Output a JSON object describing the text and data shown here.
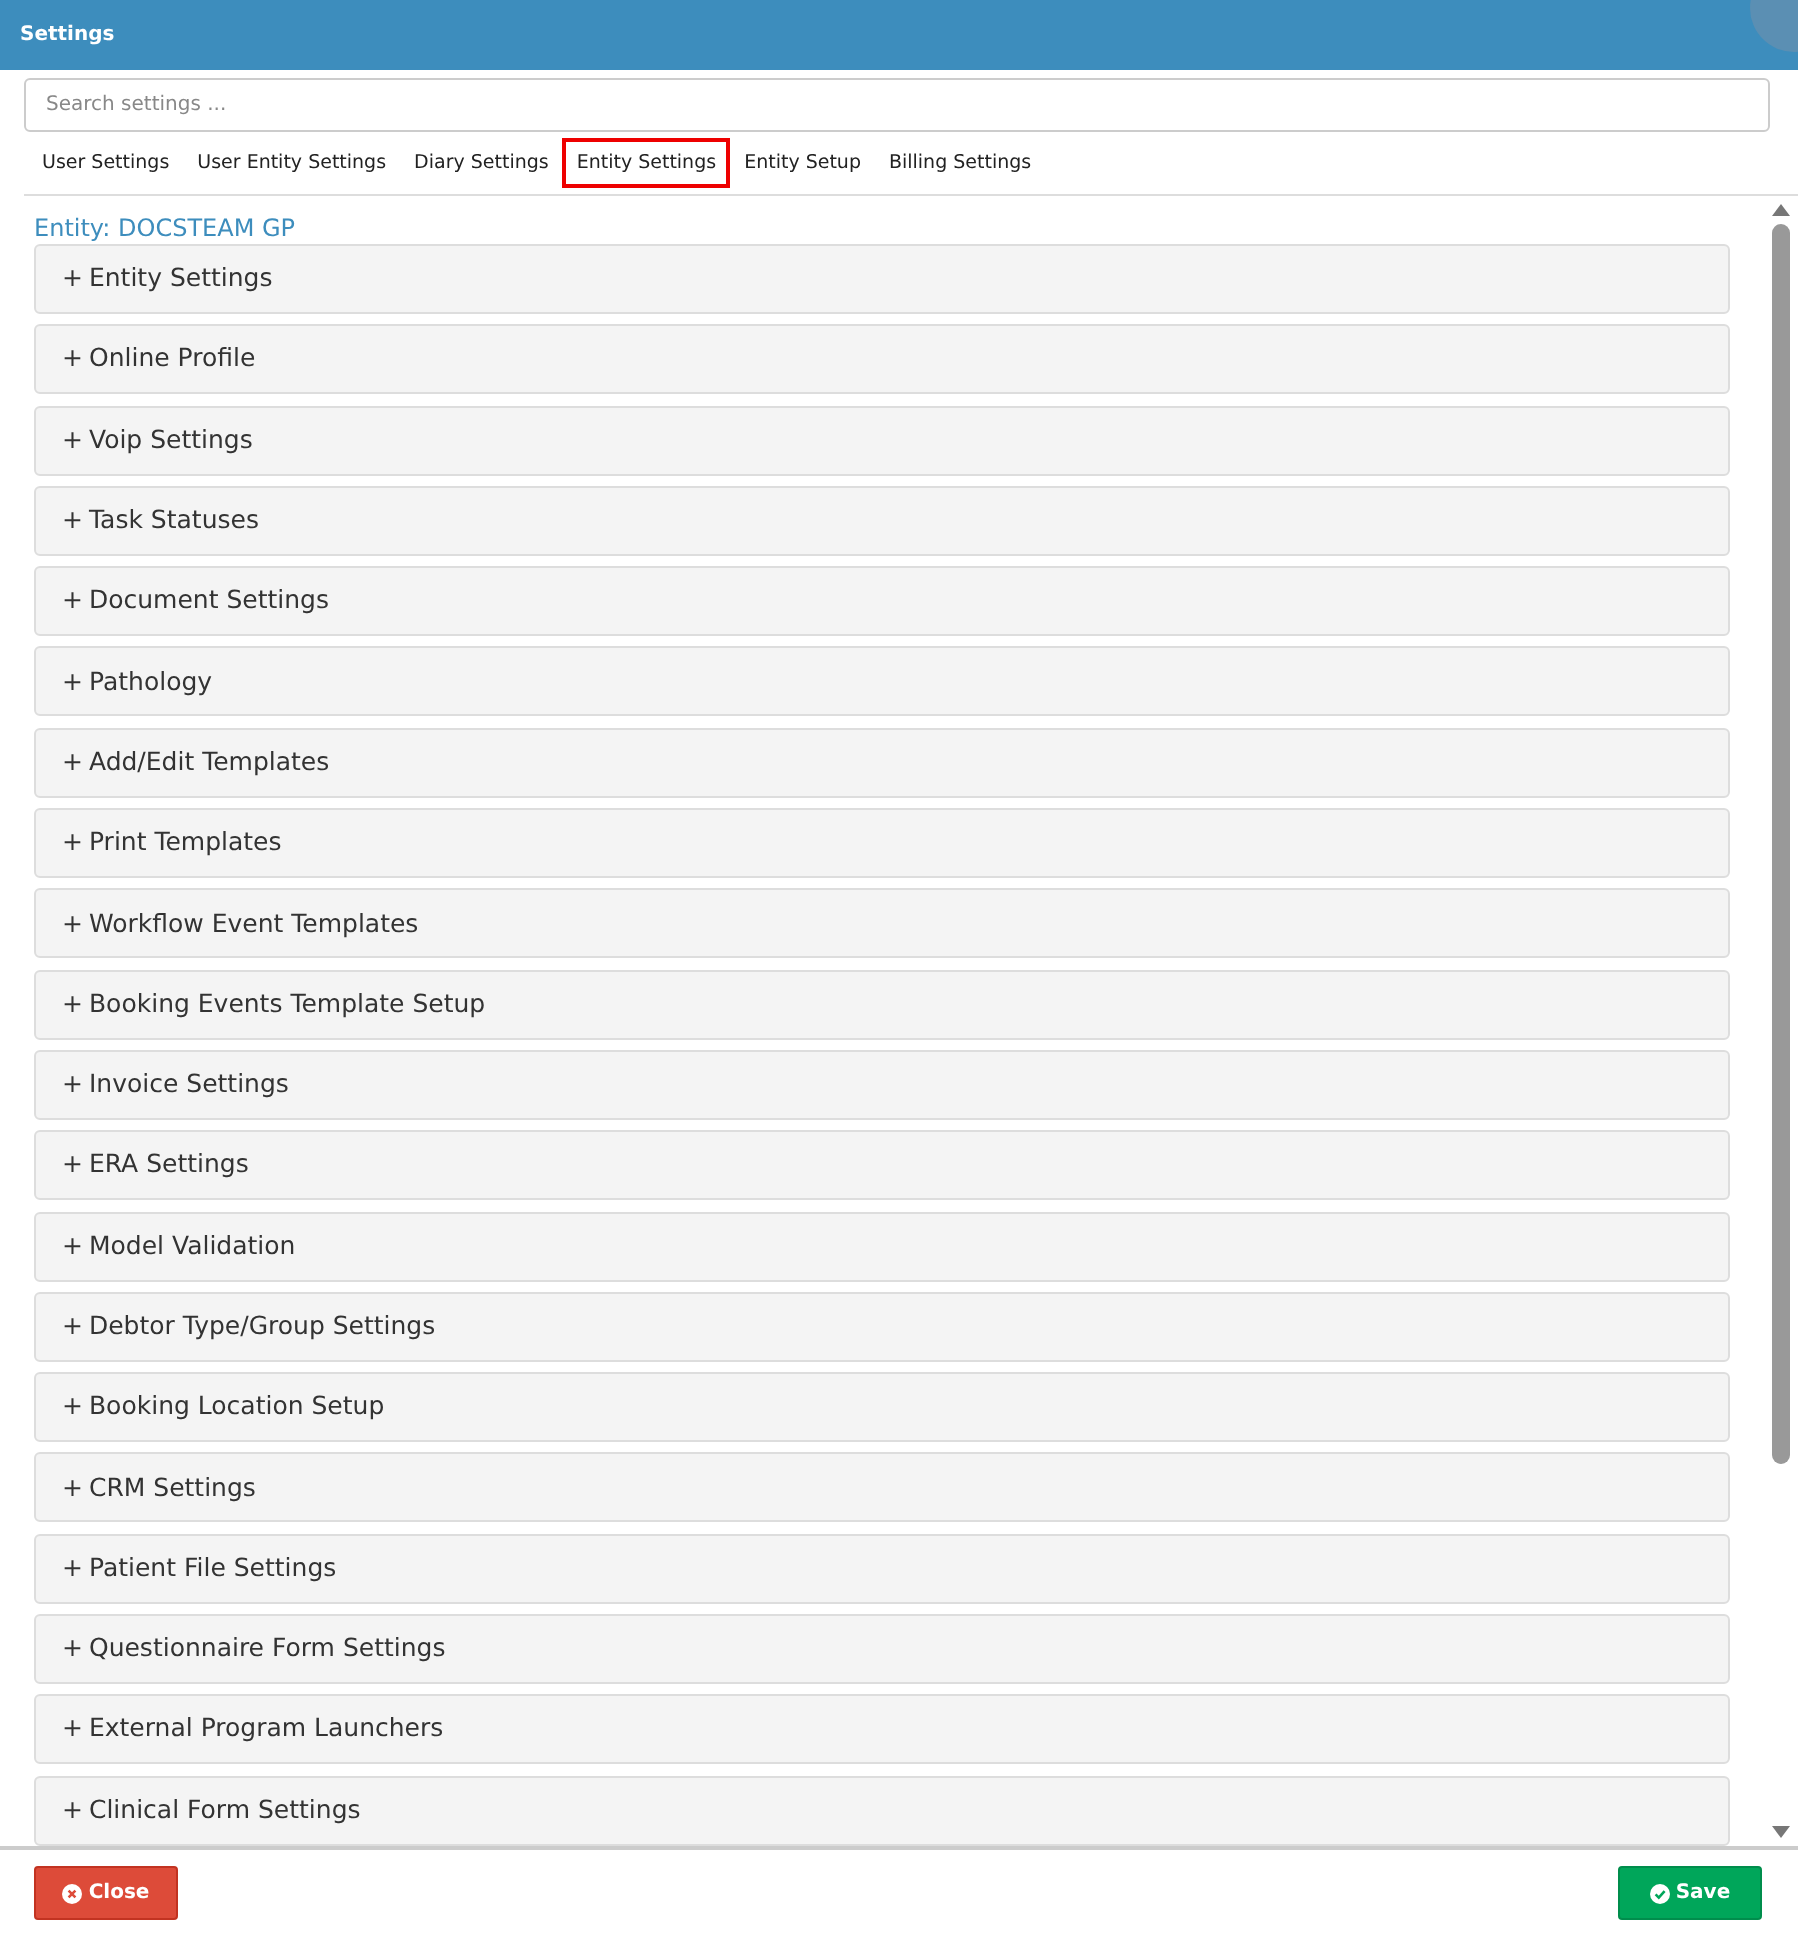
{
  "window": {
    "title": "Settings"
  },
  "search": {
    "placeholder": "Search settings ..."
  },
  "tabs": [
    {
      "label": "User Settings",
      "selected": false
    },
    {
      "label": "User Entity Settings",
      "selected": false
    },
    {
      "label": "Diary Settings",
      "selected": false
    },
    {
      "label": "Entity Settings",
      "selected": true
    },
    {
      "label": "Entity Setup",
      "selected": false
    },
    {
      "label": "Billing Settings",
      "selected": false
    }
  ],
  "entity_heading": "Entity: DOCSTEAM GP",
  "sections": [
    {
      "sign": "+",
      "label": "Entity Settings"
    },
    {
      "sign": "+",
      "label": "Online Profile"
    },
    {
      "sign": "+",
      "label": "Voip Settings"
    },
    {
      "sign": "+",
      "label": "Task Statuses"
    },
    {
      "sign": "+",
      "label": "Document Settings"
    },
    {
      "sign": "+",
      "label": "Pathology"
    },
    {
      "sign": "+",
      "label": "Add/Edit Templates"
    },
    {
      "sign": "+",
      "label": "Print Templates"
    },
    {
      "sign": "+",
      "label": "Workflow Event Templates"
    },
    {
      "sign": "+",
      "label": "Booking Events Template Setup"
    },
    {
      "sign": "+",
      "label": "Invoice Settings"
    },
    {
      "sign": "+",
      "label": "ERA Settings"
    },
    {
      "sign": "+",
      "label": "Model Validation"
    },
    {
      "sign": "+",
      "label": "Debtor Type/Group Settings"
    },
    {
      "sign": "+",
      "label": "Booking Location Setup"
    },
    {
      "sign": "+",
      "label": "CRM Settings"
    },
    {
      "sign": "+",
      "label": "Patient File Settings"
    },
    {
      "sign": "+",
      "label": "Questionnaire Form Settings"
    },
    {
      "sign": "+",
      "label": "External Program Launchers"
    },
    {
      "sign": "+",
      "label": "Clinical Form Settings"
    }
  ],
  "buttons": [
    {
      "kind": "close",
      "label": "Close"
    },
    {
      "kind": "save",
      "label": "Save"
    }
  ]
}
